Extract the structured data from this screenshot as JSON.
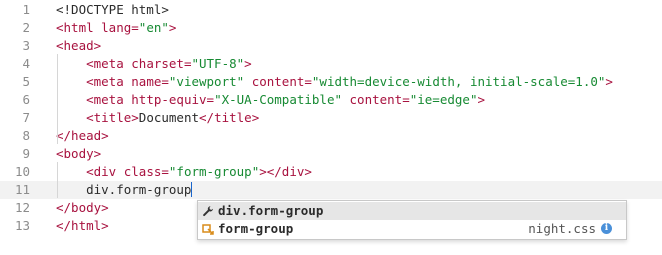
{
  "lines": [
    {
      "n": "1",
      "parts": [
        [
          "plain",
          "<!DOCTYPE html>"
        ]
      ]
    },
    {
      "n": "2",
      "parts": [
        [
          "tag",
          "<html "
        ],
        [
          "attr",
          "lang="
        ],
        [
          "str",
          "\"en\""
        ],
        [
          "tag",
          ">"
        ]
      ]
    },
    {
      "n": "3",
      "parts": [
        [
          "tag",
          "<head>"
        ]
      ]
    },
    {
      "n": "4",
      "parts": [
        [
          "plain",
          "    "
        ],
        [
          "tag",
          "<meta "
        ],
        [
          "attr",
          "charset="
        ],
        [
          "str",
          "\"UTF-8\""
        ],
        [
          "tag",
          ">"
        ]
      ]
    },
    {
      "n": "5",
      "parts": [
        [
          "plain",
          "    "
        ],
        [
          "tag",
          "<meta "
        ],
        [
          "attr",
          "name="
        ],
        [
          "str",
          "\"viewport\""
        ],
        [
          "attr",
          " content="
        ],
        [
          "str",
          "\"width=device-width, initial-scale=1.0\""
        ],
        [
          "tag",
          ">"
        ]
      ]
    },
    {
      "n": "6",
      "parts": [
        [
          "plain",
          "    "
        ],
        [
          "tag",
          "<meta "
        ],
        [
          "attr",
          "http-equiv="
        ],
        [
          "str",
          "\"X-UA-Compatible\""
        ],
        [
          "attr",
          " content="
        ],
        [
          "str",
          "\"ie=edge\""
        ],
        [
          "tag",
          ">"
        ]
      ]
    },
    {
      "n": "7",
      "parts": [
        [
          "plain",
          "    "
        ],
        [
          "tag",
          "<title>"
        ],
        [
          "plain",
          "Document"
        ],
        [
          "tag",
          "</title>"
        ]
      ]
    },
    {
      "n": "8",
      "parts": [
        [
          "tag",
          "</head>"
        ]
      ]
    },
    {
      "n": "9",
      "parts": [
        [
          "tag",
          "<body>"
        ]
      ]
    },
    {
      "n": "10",
      "parts": [
        [
          "plain",
          "    "
        ],
        [
          "tag",
          "<div "
        ],
        [
          "attr",
          "class="
        ],
        [
          "str",
          "\"form-group\""
        ],
        [
          "tag",
          "></div>"
        ]
      ]
    },
    {
      "n": "11",
      "parts": [
        [
          "plain",
          "    div.form-group"
        ]
      ],
      "active": true
    },
    {
      "n": "12",
      "parts": [
        [
          "tag",
          "</body>"
        ]
      ]
    },
    {
      "n": "13",
      "parts": [
        [
          "tag",
          "</html>"
        ]
      ]
    }
  ],
  "autocomplete": {
    "items": [
      {
        "icon": "wrench-icon",
        "label": "div.form-group",
        "source": "",
        "selected": true
      },
      {
        "icon": "css-property-icon",
        "label": "form-group",
        "source": "night.css",
        "selected": false
      }
    ],
    "info_glyph": "i"
  },
  "colors": {
    "tag": "#a8123f",
    "string": "#178a33",
    "line_number": "#8c8c8c",
    "cursor": "#1a66cc",
    "active_line": "#f2f2f2",
    "selected_suggestion": "#e6e6e6"
  }
}
